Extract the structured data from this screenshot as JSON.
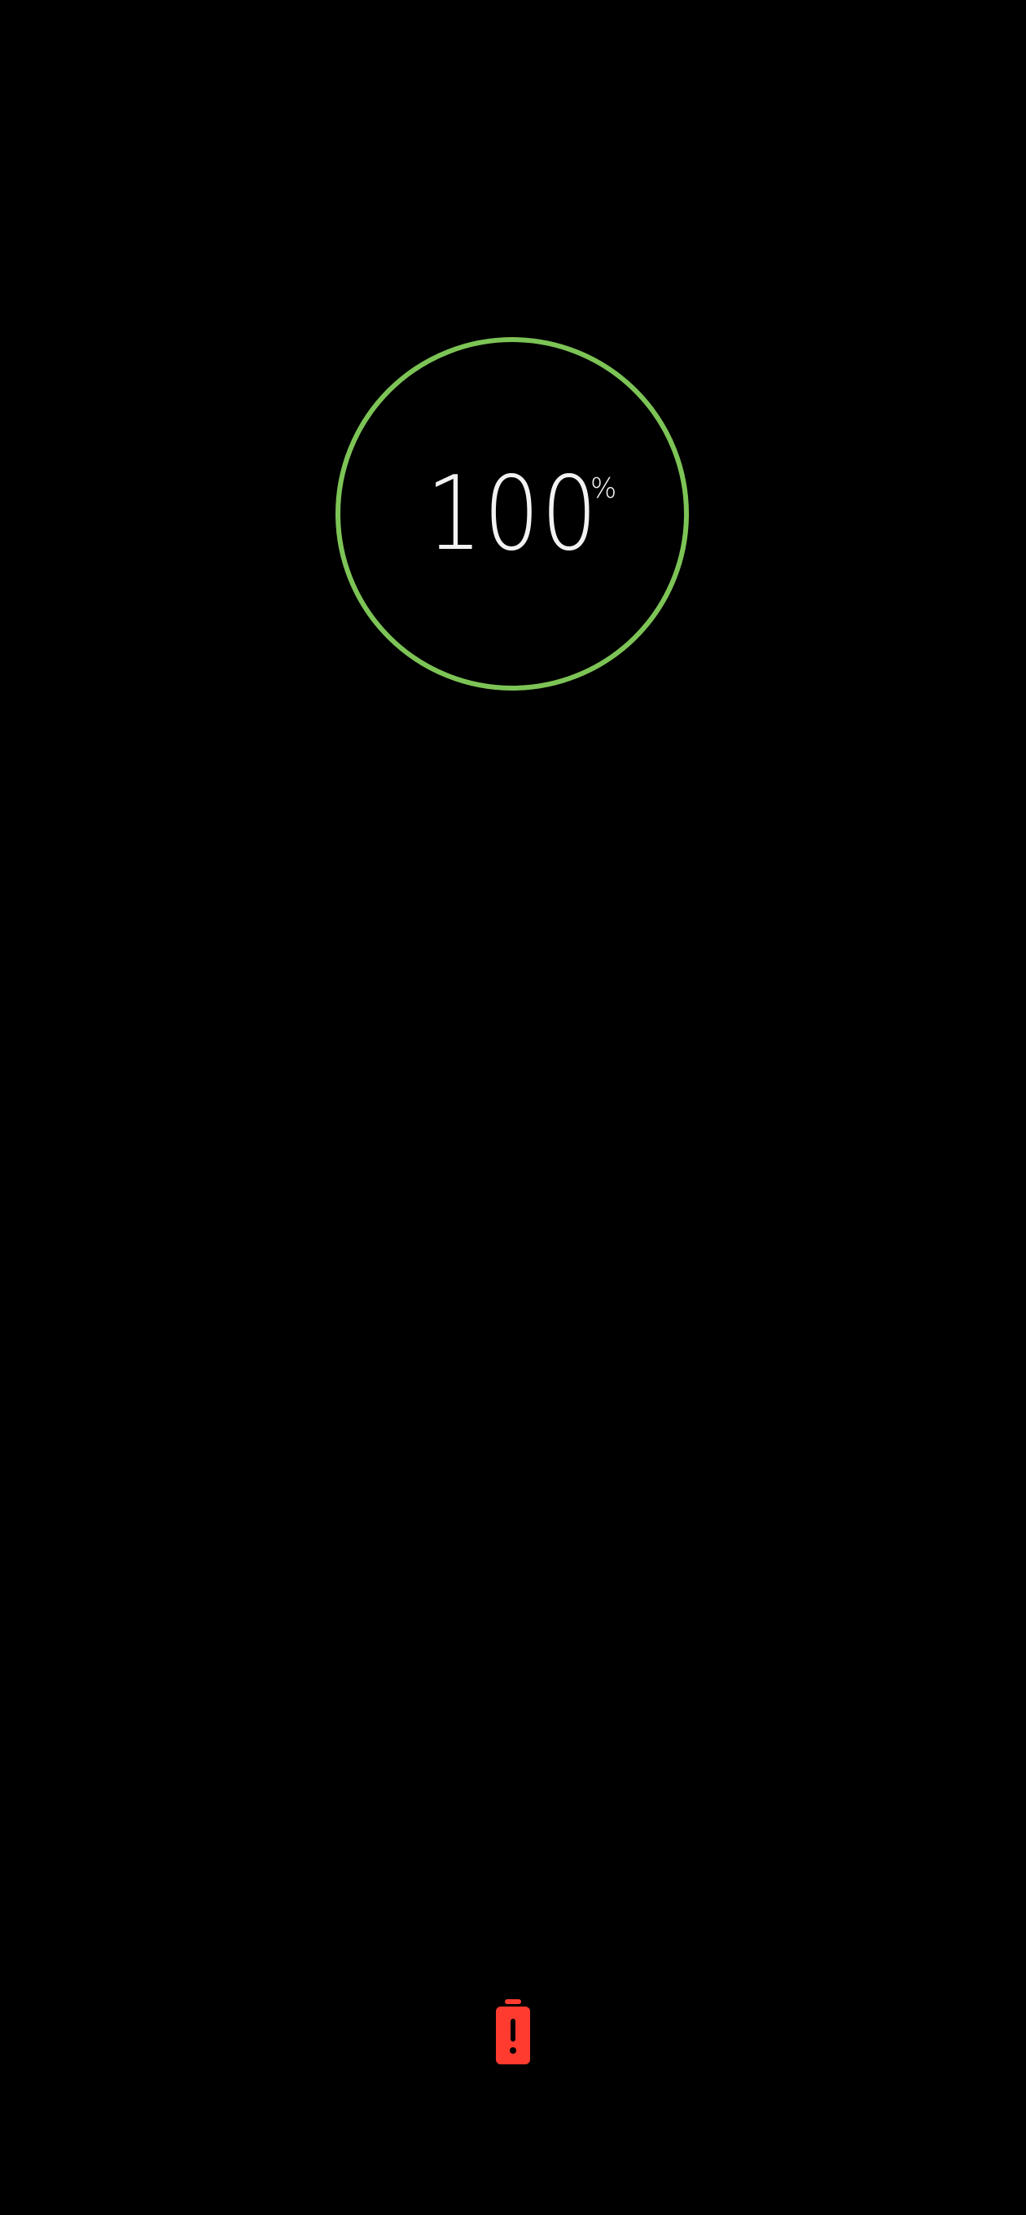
{
  "charge": {
    "value": "100",
    "unit": "%",
    "level_fraction": 1.0
  },
  "colors": {
    "background": "#000000",
    "ring": "#7dc456",
    "text": "#f2f2f2",
    "battery_alert": "#ff3b30"
  },
  "icons": {
    "status": "battery-alert-icon"
  }
}
